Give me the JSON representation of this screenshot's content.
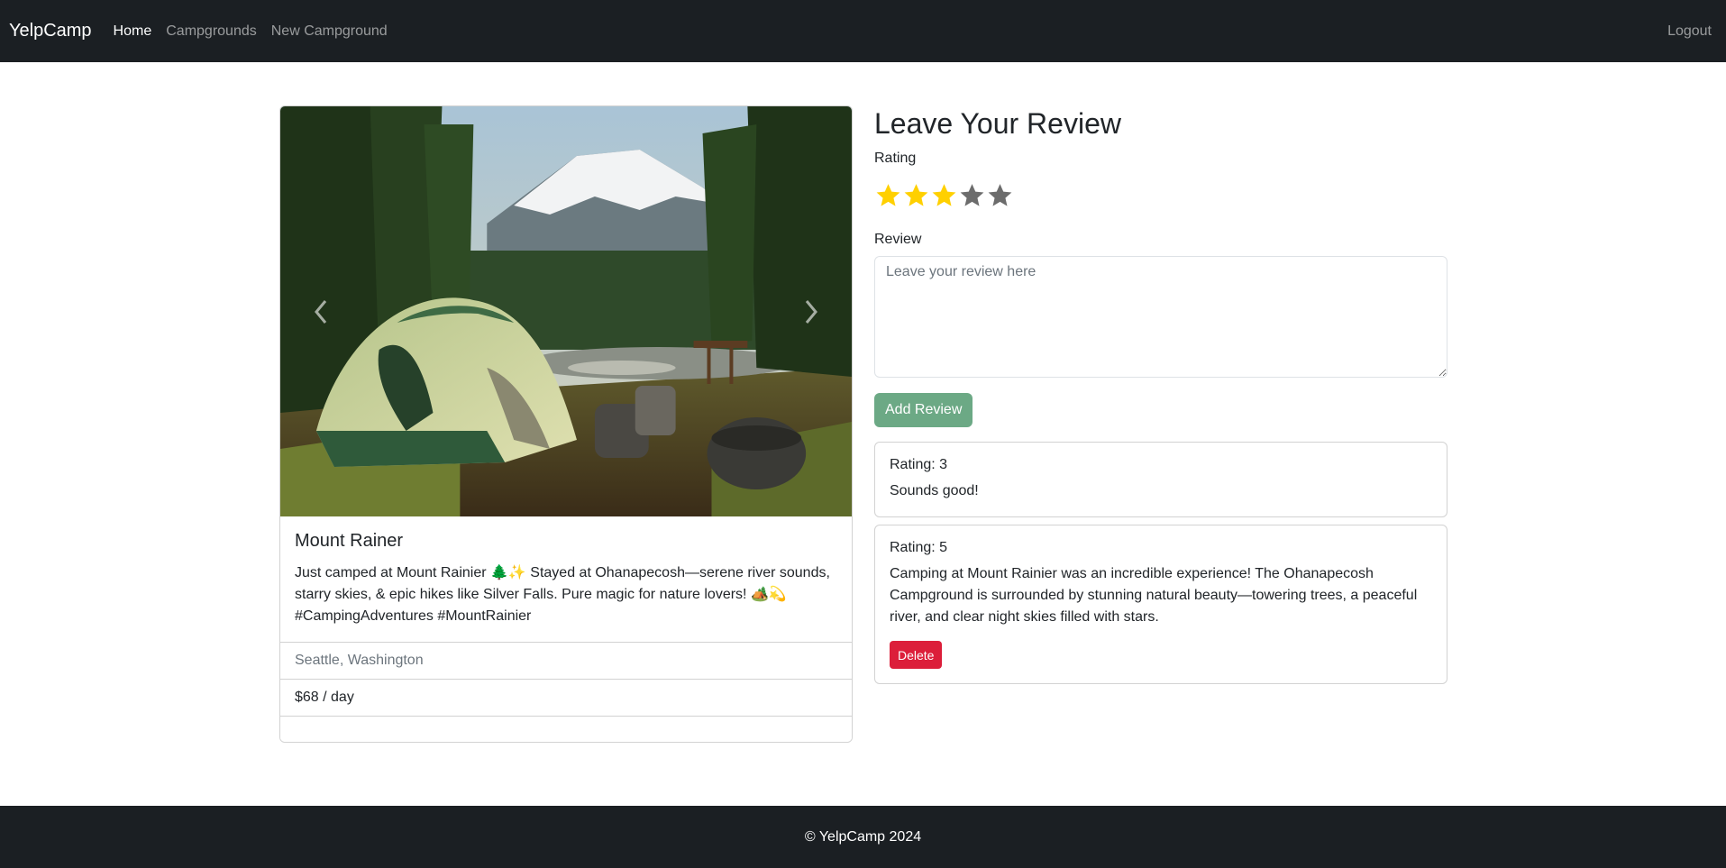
{
  "nav": {
    "brand": "YelpCamp",
    "links": [
      "Home",
      "Campgrounds",
      "New Campground"
    ],
    "logout": "Logout"
  },
  "campground": {
    "title": "Mount Rainer",
    "description": "Just camped at Mount Rainier 🌲✨ Stayed at Ohanapecosh—serene river sounds, starry skies, & epic hikes like Silver Falls. Pure magic for nature lovers! 🏕️💫 #CampingAdventures #MountRainier",
    "location": "Seattle, Washington",
    "price": "$68 / day",
    "prev_icon": "chevron-left-icon",
    "next_icon": "chevron-right-icon"
  },
  "review_form": {
    "heading": "Leave Your Review",
    "rating_label": "Rating",
    "rating_value": 3,
    "rating_max": 5,
    "review_label": "Review",
    "placeholder": "Leave your review here",
    "submit": "Add Review"
  },
  "reviews": [
    {
      "rating": "Rating: 3",
      "text": "Sounds good!"
    },
    {
      "rating": "Rating: 5",
      "text": "Camping at Mount Rainier was an incredible experience! The Ohanapecosh Campground is surrounded by stunning natural beauty—towering trees, a peaceful river, and clear night skies filled with stars.",
      "delete": "Delete"
    }
  ],
  "footer": {
    "text": "© YelpCamp 2024"
  },
  "colors": {
    "navbar": "#1b1f23",
    "star_filled": "#ffd000",
    "star_empty": "#6c6c6c",
    "add_button": "#6ca985",
    "delete_button": "#dc1e3a"
  }
}
